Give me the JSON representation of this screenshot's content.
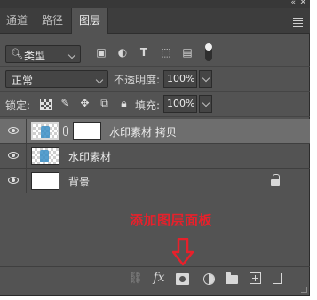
{
  "topbar": {
    "collapse_glyph": "«",
    "close_glyph": "✕"
  },
  "tabs": [
    {
      "label": "通道",
      "active": false
    },
    {
      "label": "路径",
      "active": false
    },
    {
      "label": "图层",
      "active": true
    }
  ],
  "filter": {
    "kind_label": "类型",
    "icons": [
      "image-filter-icon",
      "adjustment-filter-icon",
      "type-filter-icon",
      "shape-filter-icon",
      "smart-object-filter-icon"
    ]
  },
  "blend": {
    "mode": "正常",
    "opacity_label": "不透明度:",
    "opacity_value": "100%"
  },
  "locks": {
    "label": "锁定:",
    "fill_label": "填充:",
    "fill_value": "100%"
  },
  "layers": [
    {
      "name": "水印素材 拷贝",
      "selected": true,
      "has_mask": true,
      "locked": false
    },
    {
      "name": "水印素材",
      "selected": false,
      "has_mask": false,
      "locked": false
    },
    {
      "name": "背景",
      "selected": false,
      "has_mask": false,
      "locked": true
    }
  ],
  "annotation": {
    "text": "添加图层面板",
    "color": "#e8202b"
  },
  "bottom_icons": [
    "link-layers-icon",
    "fx-icon",
    "add-mask-icon",
    "adjustment-layer-icon",
    "group-folder-icon",
    "new-layer-icon",
    "delete-icon"
  ],
  "colors": {
    "panel": "#535353",
    "tabbar": "#3d3d3d",
    "selected_row": "#6e6e6e",
    "annotation_red": "#e8202b"
  }
}
